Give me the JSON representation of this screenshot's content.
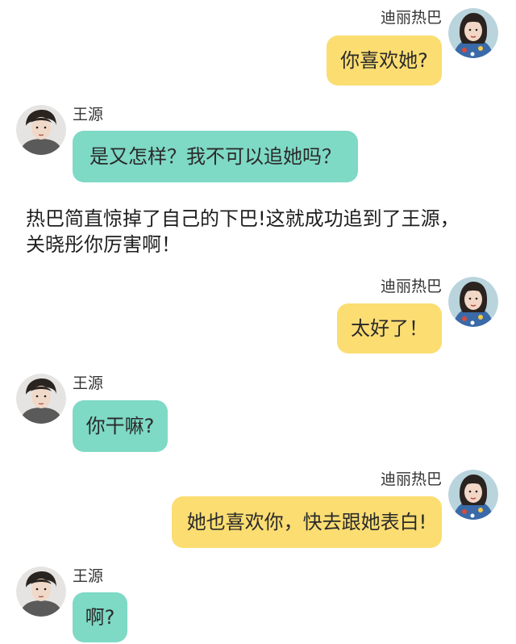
{
  "chat": {
    "messages": [
      {
        "sender": "迪丽热巴",
        "text": "你喜欢她?"
      },
      {
        "sender": "王源",
        "text": "是又怎样？我不可以追她吗？"
      },
      {
        "sender": "迪丽热巴",
        "text": "太好了！"
      },
      {
        "sender": "王源",
        "text": "你干嘛?"
      },
      {
        "sender": "迪丽热巴",
        "text": "她也喜欢你，快去跟她表白!"
      },
      {
        "sender": "王源",
        "text": "啊?"
      }
    ]
  },
  "narration": {
    "line1": "热巴简直惊掉了自己的下巴!这就成功追到了王源，",
    "line2": "关晓彤你厉害啊！"
  },
  "colors": {
    "right_bubble": "#fbdd72",
    "left_bubble": "#7ed9c5",
    "background": "#ffffff"
  },
  "icons": {
    "right_avatar": "female-avatar-icon",
    "left_avatar": "male-avatar-icon"
  }
}
